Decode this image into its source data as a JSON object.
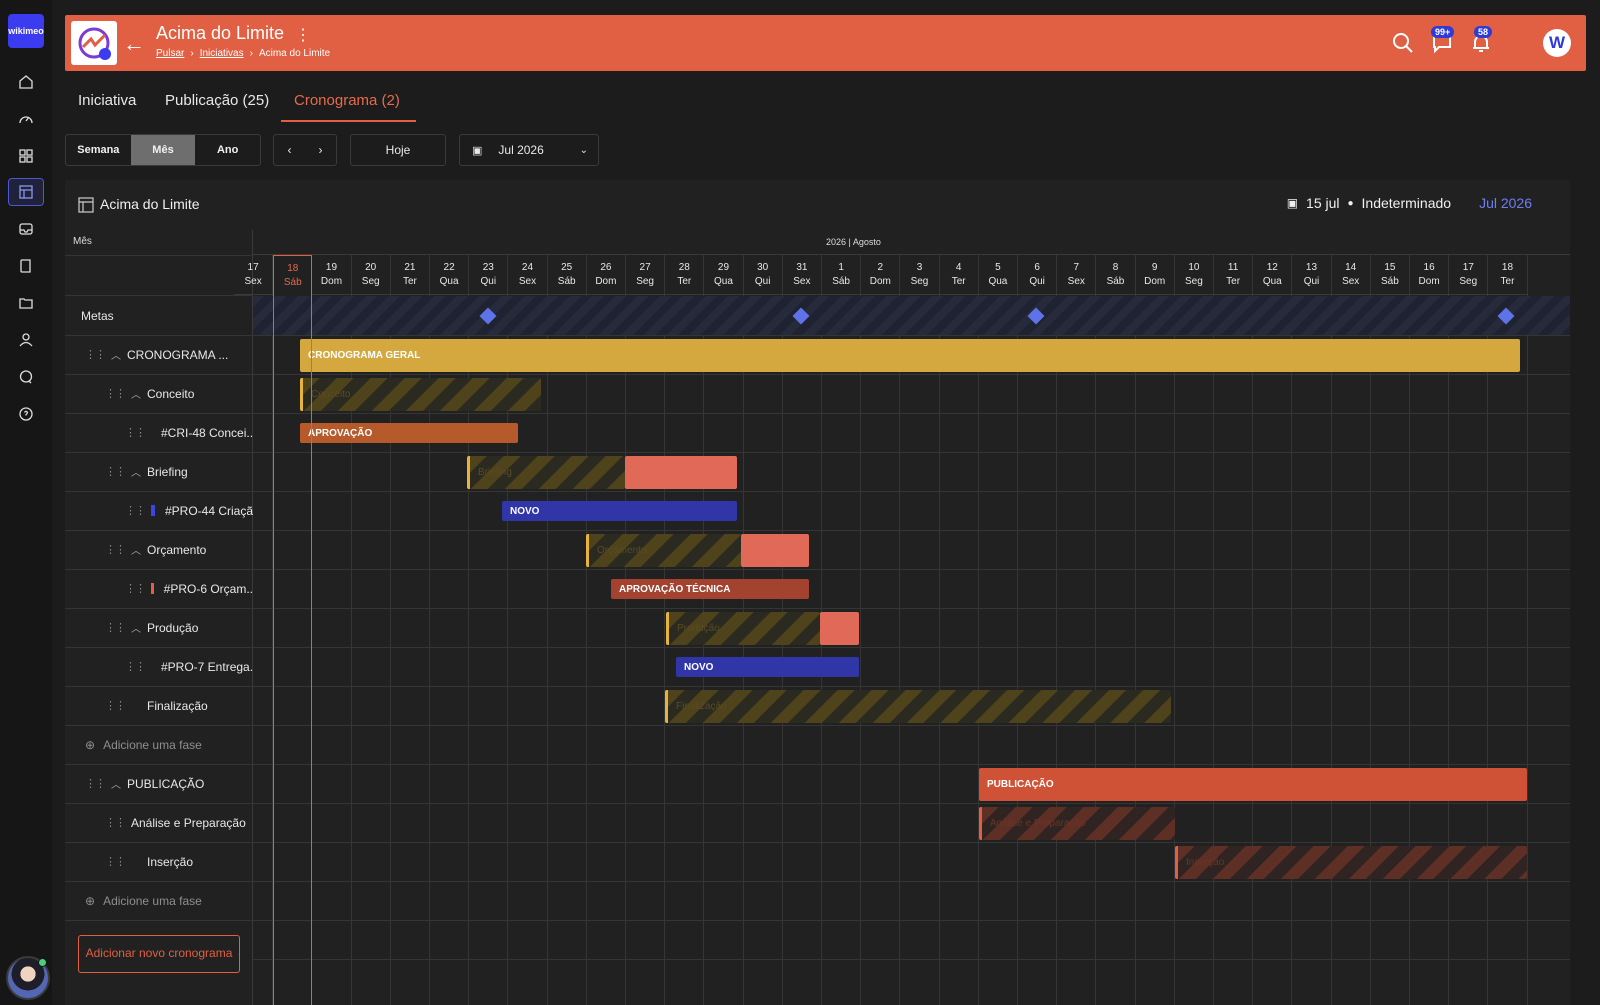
{
  "sidebar": {
    "logo": "wikimeo",
    "icons": [
      "home-icon",
      "dashboard-icon",
      "apps-icon",
      "schedule-icon",
      "inbox-icon",
      "book-icon",
      "folder-icon",
      "user-icon",
      "chat-icon",
      "help-icon"
    ]
  },
  "header": {
    "title": "Acima do Limite",
    "breadcrumb": [
      "Pulsar",
      "Iniciativas",
      "Acima do Limite"
    ],
    "messages_badge": "99+",
    "notifications_badge": "58",
    "avatar_letter": "W",
    "bg_color": "#e15f42"
  },
  "tabs": [
    "Iniciativa",
    "Publicação (25)",
    "Cronograma (2)"
  ],
  "controls": {
    "views": [
      "Semana",
      "Mês",
      "Ano"
    ],
    "active_view": "Mês",
    "today_label": "Hoje",
    "date_select": "Jul 2026"
  },
  "panel": {
    "title": "Acima do Limite",
    "date": "15 jul",
    "status": "Indeterminado",
    "month": "Jul 2026"
  },
  "gantt": {
    "mes_label": "Mês",
    "month_header": "2026 | Agosto",
    "days": [
      {
        "n": "17",
        "d": "Sex"
      },
      {
        "n": "18",
        "d": "Sáb"
      },
      {
        "n": "19",
        "d": "Dom"
      },
      {
        "n": "20",
        "d": "Seg"
      },
      {
        "n": "21",
        "d": "Ter"
      },
      {
        "n": "22",
        "d": "Qua"
      },
      {
        "n": "23",
        "d": "Qui"
      },
      {
        "n": "24",
        "d": "Sex"
      },
      {
        "n": "25",
        "d": "Sáb"
      },
      {
        "n": "26",
        "d": "Dom"
      },
      {
        "n": "27",
        "d": "Seg"
      },
      {
        "n": "28",
        "d": "Ter"
      },
      {
        "n": "29",
        "d": "Qua"
      },
      {
        "n": "30",
        "d": "Qui"
      },
      {
        "n": "31",
        "d": "Sex"
      },
      {
        "n": "1",
        "d": "Sáb"
      },
      {
        "n": "2",
        "d": "Dom"
      },
      {
        "n": "3",
        "d": "Seg"
      },
      {
        "n": "4",
        "d": "Ter"
      },
      {
        "n": "5",
        "d": "Qua"
      },
      {
        "n": "6",
        "d": "Qui"
      },
      {
        "n": "7",
        "d": "Sex"
      },
      {
        "n": "8",
        "d": "Sáb"
      },
      {
        "n": "9",
        "d": "Dom"
      },
      {
        "n": "10",
        "d": "Seg"
      },
      {
        "n": "11",
        "d": "Ter"
      },
      {
        "n": "12",
        "d": "Qua"
      },
      {
        "n": "13",
        "d": "Qui"
      },
      {
        "n": "14",
        "d": "Sex"
      },
      {
        "n": "15",
        "d": "Sáb"
      },
      {
        "n": "16",
        "d": "Dom"
      },
      {
        "n": "17",
        "d": "Seg"
      },
      {
        "n": "18",
        "d": "Ter"
      }
    ],
    "rows": [
      {
        "label": "Metas"
      },
      {
        "label": "CRONOGRAMA ..."
      },
      {
        "label": "Conceito"
      },
      {
        "label": "#CRI-48 Concei..",
        "color": "#e8743c"
      },
      {
        "label": "Briefing"
      },
      {
        "label": "#PRO-44 Criaçã",
        "color": "#3b45e0"
      },
      {
        "label": "Orçamento"
      },
      {
        "label": "#PRO-6 Orçam..",
        "color": "#e15f42"
      },
      {
        "label": "Produção"
      },
      {
        "label": "#PRO-7 Entrega..",
        "color": "#3b45e0"
      },
      {
        "label": "Finalização"
      },
      {
        "label": "Adicione uma fase"
      },
      {
        "label": "PUBLICAÇÃO"
      },
      {
        "label": "Análise e Preparação"
      },
      {
        "label": "Inserção"
      },
      {
        "label": "Adicione uma fase"
      }
    ],
    "bars": {
      "cronograma_geral": "CRONOGRAMA GERAL",
      "conceito": "Conceito",
      "aprovacao": "APROVAÇÃO",
      "briefing": "Briefing",
      "novo1": "NOVO",
      "orcamento": "Orçamento",
      "aprovacao_tecnica": "APROVAÇÃO TÉCNICA",
      "producao": "Produção",
      "novo2": "NOVO",
      "finalizacao": "Finalização",
      "publicacao": "PUBLICAÇÃO",
      "analise": "Análise e Preparação",
      "insercao": "Inserção"
    },
    "add_schedule": "Adicionar novo cronograma"
  }
}
